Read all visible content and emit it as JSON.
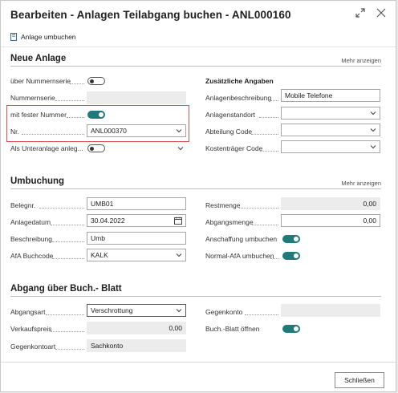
{
  "dialog": {
    "title": "Bearbeiten - Anlagen Teilabgang buchen - ANL000160",
    "action_label": "Anlage umbuchen",
    "close_label": "Schließen"
  },
  "neue_anlage": {
    "title": "Neue Anlage",
    "more": "Mehr anzeigen",
    "ueber_nummernserie_label": "über Nummernserie",
    "ueber_nummernserie_on": false,
    "nummernserie_label": "Nummernserie",
    "nummernserie_value": "",
    "mit_fester_nummer_label": "mit fester Nummer",
    "mit_fester_nummer_on": true,
    "nr_label": "Nr.",
    "nr_value": "ANL000370",
    "unteranlage_label": "Als Unteranlage anleg...",
    "unteranlage_on": false,
    "zusaetzliche_angaben": "Zusätzliche Angaben",
    "anlagenbeschreibung_label": "Anlagenbeschreibung",
    "anlagenbeschreibung_value": "Mobile Telefone",
    "anlagenstandort_label": "Anlagenstandort",
    "anlagenstandort_value": "",
    "abteilung_label": "Abteilung Code",
    "abteilung_value": "",
    "kostentraeger_label": "Kostenträger Code",
    "kostentraeger_value": ""
  },
  "umbuchung": {
    "title": "Umbuchung",
    "more": "Mehr anzeigen",
    "belegnr_label": "Belegnr.",
    "belegnr_value": "UMB01",
    "anlagedatum_label": "Anlagedatum",
    "anlagedatum_value": "30.04.2022",
    "beschreibung_label": "Beschreibung",
    "beschreibung_value": "Umb",
    "afa_buchcode_label": "AfA Buchcode",
    "afa_buchcode_value": "KALK",
    "restmenge_label": "Restmenge",
    "restmenge_value": "0,00",
    "abgangsmenge_label": "Abgangsmenge",
    "abgangsmenge_value": "0,00",
    "anschaffung_label": "Anschaffung umbuchen",
    "anschaffung_on": true,
    "normal_afa_label": "Normal-AfA umbuchen",
    "normal_afa_on": true
  },
  "abgang": {
    "title": "Abgang über Buch.- Blatt",
    "abgangsart_label": "Abgangsart",
    "abgangsart_value": "Verschrottung",
    "verkaufspreis_label": "Verkaufspreis",
    "verkaufspreis_value": "0,00",
    "gegenkontoart_label": "Gegenkontoart",
    "gegenkontoart_value": "Sachkonto",
    "gegenkonto_label": "Gegenkonto",
    "gegenkonto_value": "",
    "buchblatt_label": "Buch.-Blatt öffnen",
    "buchblatt_on": true
  },
  "colors": {
    "toggle_on": "#1f7a7a",
    "highlight": "#d9534f"
  }
}
